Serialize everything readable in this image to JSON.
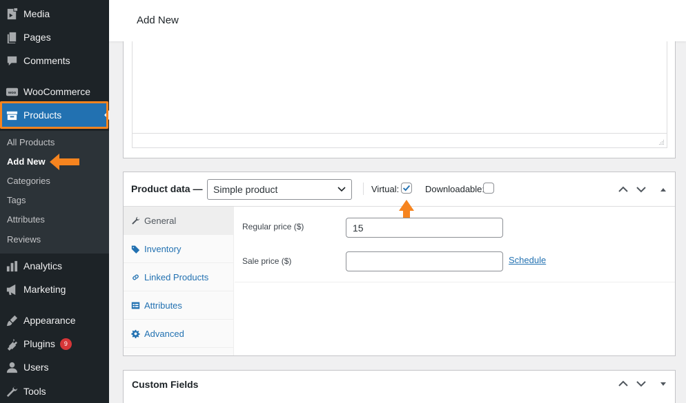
{
  "sidebar": {
    "items": [
      {
        "label": "Media",
        "icon": "media-icon"
      },
      {
        "label": "Pages",
        "icon": "pages-icon"
      },
      {
        "label": "Comments",
        "icon": "comments-icon"
      },
      {
        "label": "WooCommerce",
        "icon": "woocommerce-icon"
      },
      {
        "label": "Products",
        "icon": "products-icon",
        "current": true
      },
      {
        "label": "Analytics",
        "icon": "analytics-icon"
      },
      {
        "label": "Marketing",
        "icon": "marketing-icon"
      },
      {
        "label": "Appearance",
        "icon": "appearance-icon"
      },
      {
        "label": "Plugins",
        "icon": "plugins-icon",
        "badge": "9"
      },
      {
        "label": "Users",
        "icon": "users-icon"
      },
      {
        "label": "Tools",
        "icon": "tools-icon"
      }
    ],
    "submenu": [
      "All Products",
      "Add New",
      "Categories",
      "Tags",
      "Attributes",
      "Reviews"
    ],
    "submenu_current": "Add New"
  },
  "header": {
    "title": "Add New"
  },
  "product_data": {
    "title": "Product data —",
    "type_select": "Simple product",
    "virtual_label": "Virtual:",
    "virtual_checked": true,
    "downloadable_label": "Downloadable:",
    "downloadable_checked": false,
    "tabs": [
      {
        "label": "General",
        "icon": "wrench-icon",
        "active": true
      },
      {
        "label": "Inventory",
        "icon": "tag-icon"
      },
      {
        "label": "Linked Products",
        "icon": "link-icon"
      },
      {
        "label": "Attributes",
        "icon": "list-icon"
      },
      {
        "label": "Advanced",
        "icon": "gear-icon"
      }
    ],
    "regular_price_label": "Regular price ($)",
    "regular_price_value": "15",
    "sale_price_label": "Sale price ($)",
    "sale_price_value": "",
    "schedule_link": "Schedule"
  },
  "custom_fields": {
    "title": "Custom Fields"
  },
  "colors": {
    "sidebar_bg": "#1d2327",
    "submenu_bg": "#2c3338",
    "accent_blue": "#2271b1",
    "highlight_orange": "#f6841f",
    "badge_red": "#d63638"
  }
}
